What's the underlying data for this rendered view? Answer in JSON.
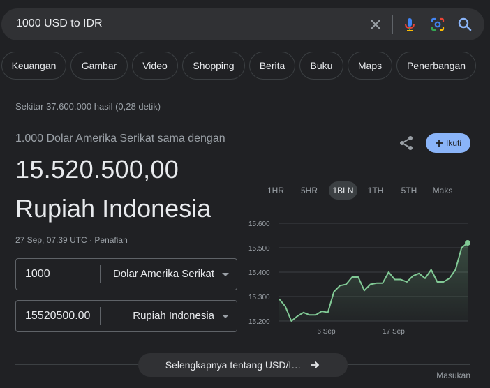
{
  "search": {
    "query": "1000 USD to IDR",
    "icons": [
      "close-icon",
      "mic-icon",
      "lens-icon",
      "search-icon"
    ]
  },
  "chips": [
    {
      "label": "Keuangan"
    },
    {
      "label": "Gambar"
    },
    {
      "label": "Video"
    },
    {
      "label": "Shopping"
    },
    {
      "label": "Berita"
    },
    {
      "label": "Buku"
    },
    {
      "label": "Maps"
    },
    {
      "label": "Penerbangan"
    }
  ],
  "result_stats": "Sekitar 37.600.000 hasil (0,28 detik)",
  "converter": {
    "from_line": "1.000 Dolar Amerika Serikat sama dengan",
    "to_amount": "15.520.500,00",
    "to_currency": "Rupiah Indonesia",
    "timestamp": "27 Sep, 07.39 UTC · Penafian",
    "from_value": "1000",
    "from_currency": "Dolar Amerika Serikat",
    "to_value": "15520500.00",
    "to_currency_select": "Rupiah Indonesia"
  },
  "actions": {
    "follow_label": "Ikuti"
  },
  "ranges": [
    {
      "label": "1HR",
      "active": false
    },
    {
      "label": "5HR",
      "active": false
    },
    {
      "label": "1BLN",
      "active": true
    },
    {
      "label": "1TH",
      "active": false
    },
    {
      "label": "5TH",
      "active": false
    },
    {
      "label": "Maks",
      "active": false
    }
  ],
  "chart_data": {
    "type": "area",
    "title": "",
    "xlabel": "",
    "ylabel": "",
    "ylim": [
      15200,
      15600
    ],
    "yticks": [
      15600,
      15500,
      15400,
      15300,
      15200
    ],
    "ytick_labels": [
      "15.600",
      "15.500",
      "15.400",
      "15.300",
      "15.200"
    ],
    "xticks": [
      {
        "x": 8,
        "label": "6 Sep"
      },
      {
        "x": 18,
        "label": "17 Sep"
      }
    ],
    "x": [
      1,
      2,
      3,
      4,
      5,
      6,
      7,
      8,
      9,
      10,
      11,
      12,
      13,
      14,
      15,
      16,
      17,
      18,
      19,
      20,
      21,
      22,
      23,
      24,
      25,
      26,
      27,
      28,
      29
    ],
    "series": [
      {
        "values": [
          15290,
          15260,
          15200,
          15220,
          15235,
          15225,
          15225,
          15240,
          15235,
          15320,
          15345,
          15350,
          15380,
          15380,
          15325,
          15350,
          15355,
          15355,
          15400,
          15370,
          15370,
          15360,
          15385,
          15395,
          15375,
          15410,
          15360,
          15360,
          15375,
          15410,
          15500,
          15520
        ]
      }
    ],
    "grid": true,
    "line_color": "#81c995"
  },
  "more_label": "Selengkapnya tentang USD/I…",
  "feedback_label": "Masukan"
}
